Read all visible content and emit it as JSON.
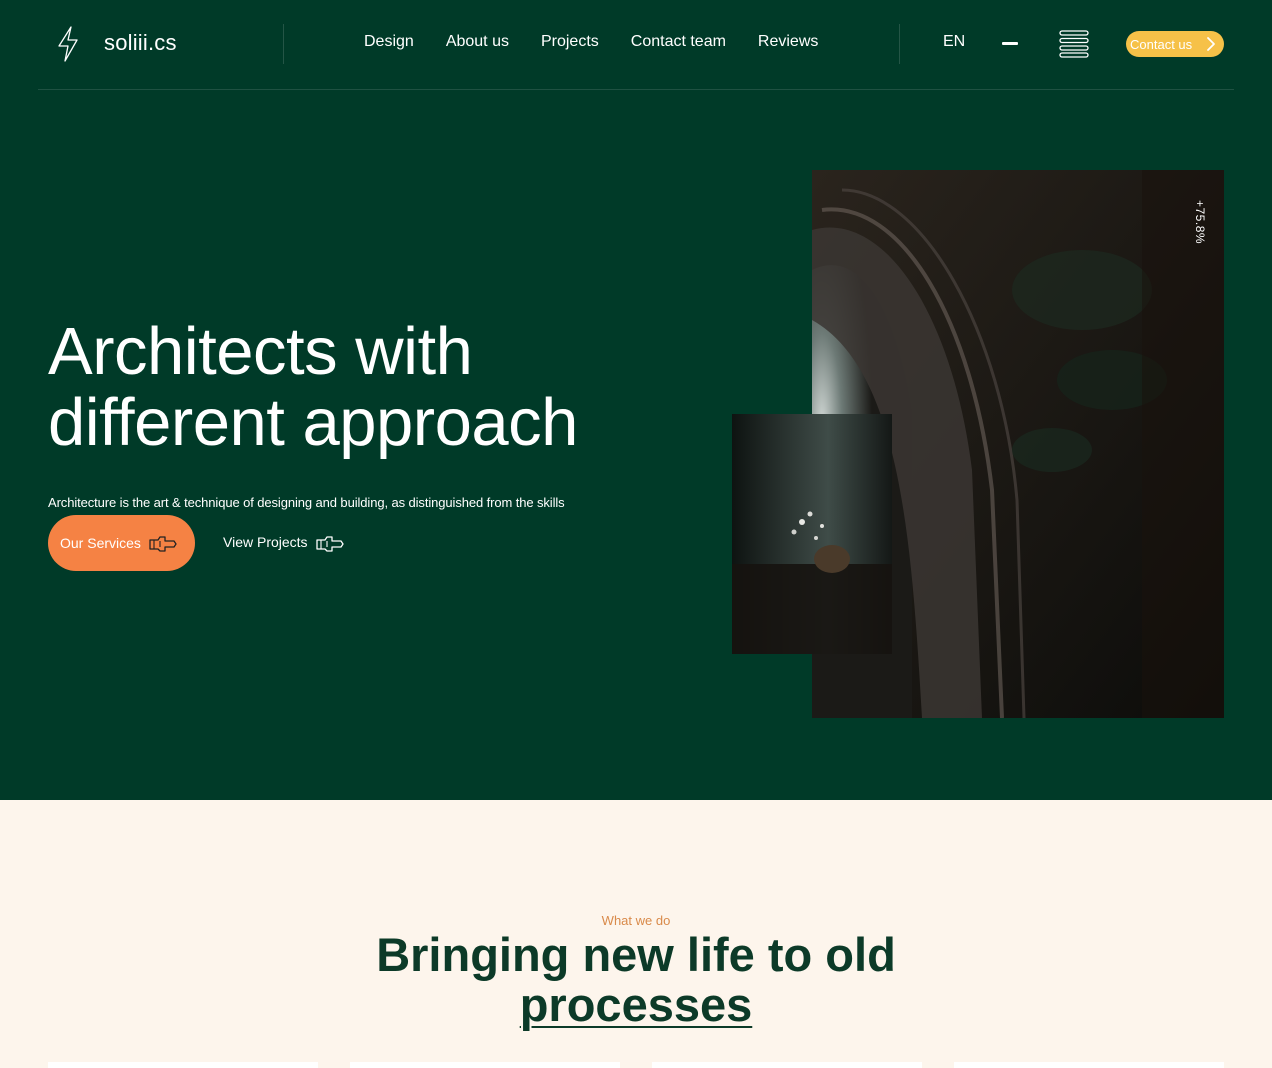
{
  "brand": {
    "name": "soliii.cs"
  },
  "nav": {
    "links": [
      "Design",
      "About us",
      "Projects",
      "Contact team",
      "Reviews"
    ],
    "language": "EN",
    "contact_label": "Contact us"
  },
  "hero": {
    "headline_line1": "Architects with",
    "headline_line2": "different approach",
    "subtext": "Architecture is the art & technique of designing and building, as distinguished from the skills",
    "primary_button": "Our Services",
    "secondary_button": "View Projects",
    "image_badge": "+75.8%"
  },
  "section": {
    "eyebrow": "What we do",
    "title_line1": "Bringing new life to old",
    "title_line2": "processes"
  },
  "colors": {
    "hero_bg": "#003a28",
    "page_bg": "#fdf5ec",
    "accent_orange": "#f58244",
    "accent_yellow": "#f6c148",
    "eyebrow": "#d98a4a",
    "title": "#0c3a28"
  },
  "icons": [
    "lightning-icon",
    "minus-icon",
    "menu-icon",
    "chevron-right-icon",
    "pointing-hand-icon"
  ]
}
